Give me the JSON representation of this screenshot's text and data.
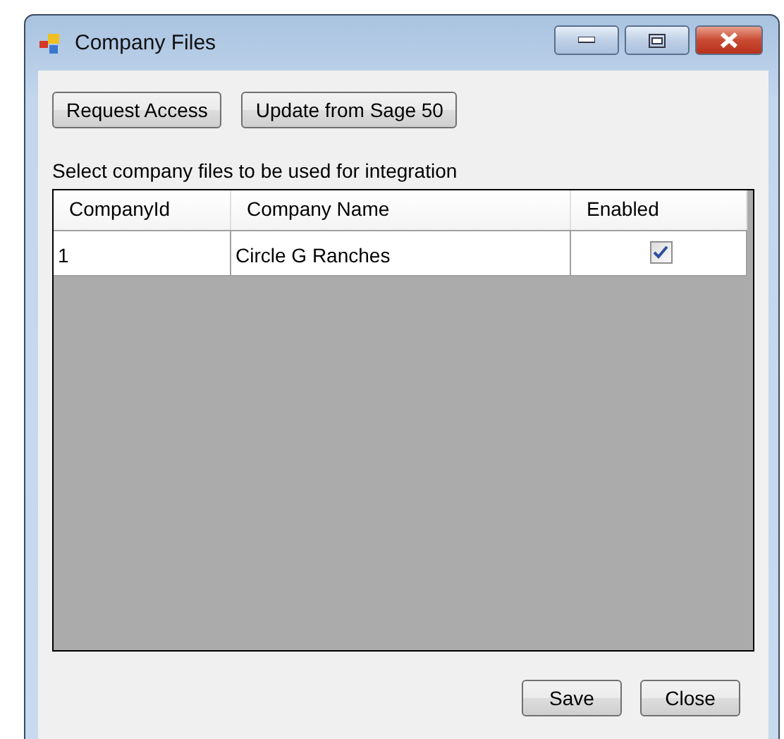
{
  "window": {
    "title": "Company Files"
  },
  "toolbar_buttons": [
    "Request Access",
    "Update from Sage 50"
  ],
  "instruction": "Select company files to be used for integration",
  "table": {
    "columns": [
      "CompanyId",
      "Company Name",
      "Enabled"
    ],
    "rows": [
      {
        "company_id": "1",
        "company_name": "Circle G Ranches",
        "enabled": true
      }
    ]
  },
  "footer_buttons": [
    "Save",
    "Close"
  ]
}
